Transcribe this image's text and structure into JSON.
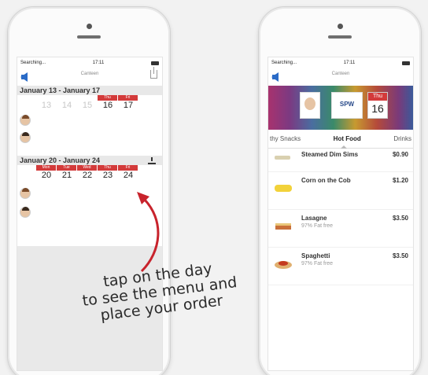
{
  "left_phone": {
    "status": {
      "carrier": "Searching...",
      "time": "17:11"
    },
    "nav": {
      "title": "Canteen"
    },
    "weeks": [
      {
        "range": "January 13 - January 17",
        "days": [
          {
            "name": "",
            "num": "13",
            "dim": true
          },
          {
            "name": "",
            "num": "14",
            "dim": true
          },
          {
            "name": "",
            "num": "15",
            "dim": true
          },
          {
            "name": "Thu",
            "num": "16",
            "dim": false
          },
          {
            "name": "Fri",
            "num": "17",
            "dim": false
          }
        ]
      },
      {
        "range": "January 20 - January 24",
        "days": [
          {
            "name": "Mon",
            "num": "20",
            "dim": false
          },
          {
            "name": "Tue",
            "num": "21",
            "dim": false
          },
          {
            "name": "Wed",
            "num": "22",
            "dim": false
          },
          {
            "name": "Thu",
            "num": "23",
            "dim": false
          },
          {
            "name": "Fri",
            "num": "24",
            "dim": false
          }
        ]
      }
    ]
  },
  "right_phone": {
    "status": {
      "carrier": "Searching...",
      "time": "17:11"
    },
    "nav": {
      "title": "Canteen"
    },
    "banner": {
      "logo": "SPW",
      "cal_day": "Thu",
      "cal_num": "16"
    },
    "tabs": [
      "thy Snacks",
      "Hot Food",
      "Drinks"
    ],
    "active_tab": "Hot Food",
    "menu": [
      {
        "name": "Steamed Dim Sims",
        "desc": "",
        "price": "$0.90"
      },
      {
        "name": "Corn on the Cob",
        "desc": "",
        "price": "$1.20"
      },
      {
        "name": "Lasagne",
        "desc": "97% Fat free",
        "price": "$3.50"
      },
      {
        "name": "Spaghetti",
        "desc": "97% Fat free",
        "price": "$3.50"
      }
    ]
  },
  "caption": {
    "line1": "tap on the day",
    "line2": "to see the menu and",
    "line3": "place your order"
  },
  "colors": {
    "accent_red": "#d33a3a",
    "nav_blue": "#2a6bc7"
  }
}
